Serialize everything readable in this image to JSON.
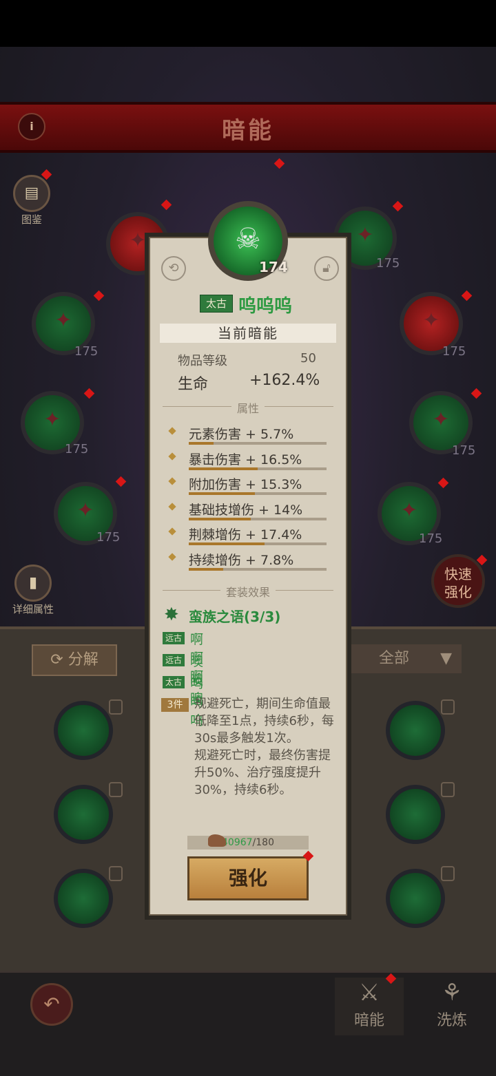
{
  "header": {
    "title": "暗能",
    "info_icon": "info-icon"
  },
  "side": {
    "atlas_label": "图鉴",
    "detail_label": "详细属性",
    "fast_label_1": "快速",
    "fast_label_2": "强化"
  },
  "nodes": {
    "level_175": "175"
  },
  "inventory": {
    "decompose_label": "分解",
    "filter_label": "全部"
  },
  "nav": {
    "dark_energy_label": "暗能",
    "refine_label": "洗炼"
  },
  "card": {
    "level": "174",
    "rarity": "太古",
    "name": "呜呜呜",
    "section_current": "当前暗能",
    "item_level_label": "物品等级",
    "item_level_value": "50",
    "life_label": "生命",
    "life_value": "+162.4%",
    "attr_header": "属性",
    "attributes": [
      {
        "text": "元素伤害 + 5.7%",
        "fill": 0.18
      },
      {
        "text": "暴击伤害 + 16.5%",
        "fill": 0.5
      },
      {
        "text": "附加伤害 + 15.3%",
        "fill": 0.48
      },
      {
        "text": "基础技增伤 + 14%",
        "fill": 0.45
      },
      {
        "text": "荆棘增伤 + 17.4%",
        "fill": 0.55
      },
      {
        "text": "持续增伤 + 7.8%",
        "fill": 0.25
      }
    ],
    "set_header": "套装效果",
    "set_title": "蛮族之语(3/3)",
    "set_pieces": [
      {
        "tag": "远古",
        "name": "啊啊啊"
      },
      {
        "tag": "远古",
        "name": "噢噢噢"
      },
      {
        "tag": "太古",
        "name": "呜呜呜"
      }
    ],
    "set_tag": "3件",
    "set_desc": "规避死亡，期间生命值最低降至1点，持续6秒，每30s最多触发1次。\n规避死亡时，最终伤害提升50%、治疗强度提升30%，持续6秒。",
    "cost_have": "40967",
    "cost_need": "/180",
    "upgrade_label": "强化"
  }
}
